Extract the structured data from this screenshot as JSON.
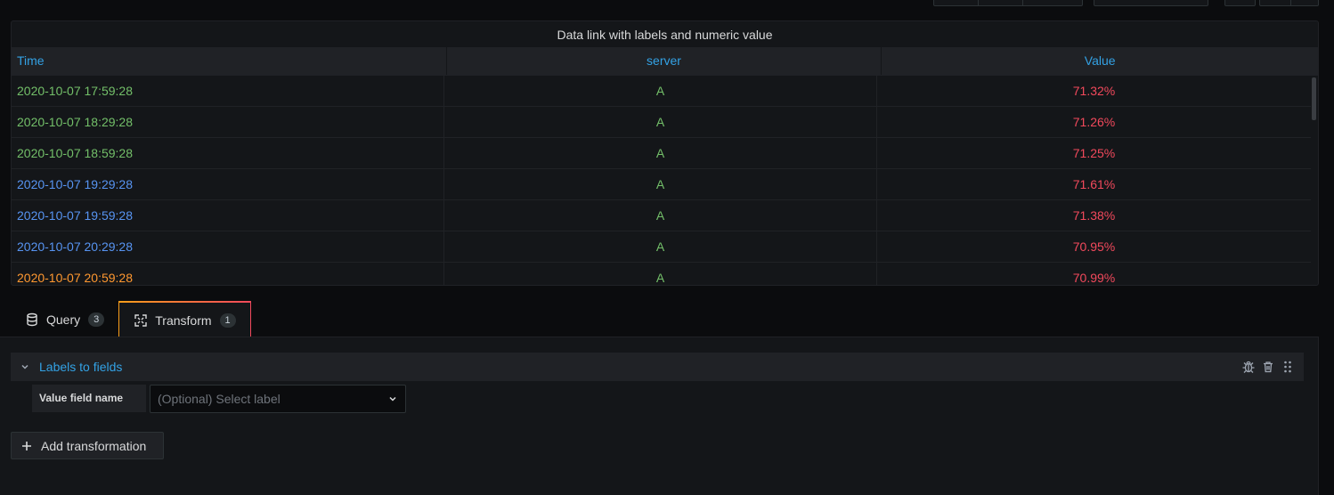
{
  "panel": {
    "title": "Data link with labels and numeric value",
    "columns": [
      "Time",
      "server",
      "Value"
    ],
    "rows": [
      {
        "time": "2020-10-07 17:59:28",
        "server": "A",
        "value": "71.32%",
        "time_color": "#73bf69"
      },
      {
        "time": "2020-10-07 18:29:28",
        "server": "A",
        "value": "71.26%",
        "time_color": "#73bf69"
      },
      {
        "time": "2020-10-07 18:59:28",
        "server": "A",
        "value": "71.25%",
        "time_color": "#73bf69"
      },
      {
        "time": "2020-10-07 19:29:28",
        "server": "A",
        "value": "71.61%",
        "time_color": "#5794f2"
      },
      {
        "time": "2020-10-07 19:59:28",
        "server": "A",
        "value": "71.38%",
        "time_color": "#5794f2"
      },
      {
        "time": "2020-10-07 20:29:28",
        "server": "A",
        "value": "70.95%",
        "time_color": "#5794f2"
      },
      {
        "time": "2020-10-07 20:59:28",
        "server": "A",
        "value": "70.99%",
        "time_color": "#ff9830"
      }
    ]
  },
  "tabs": [
    {
      "label": "Query",
      "count": "3",
      "icon": "database-icon"
    },
    {
      "label": "Transform",
      "count": "1",
      "icon": "transform-icon"
    }
  ],
  "transformation": {
    "name": "Labels to fields",
    "field_label": "Value field name",
    "select_placeholder": "(Optional) Select label"
  },
  "add_button_label": "Add transformation",
  "colors": {
    "accent": "#33a2e5",
    "server": "#73bf69",
    "value": "#f2495c"
  }
}
